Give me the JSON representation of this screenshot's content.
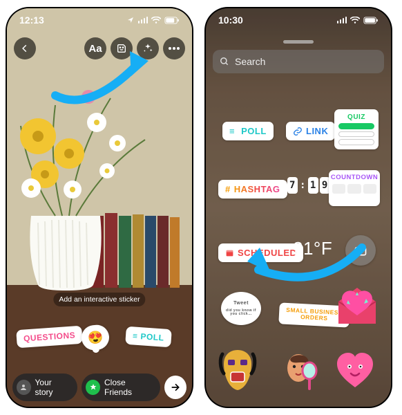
{
  "left": {
    "status_time": "12:13",
    "status_location_icon": "location",
    "hint_text": "Add an interactive sticker",
    "top_buttons": {
      "text": "Aa",
      "sticker": "sticker-icon",
      "effects": "sparkle-icon",
      "more": "more-icon"
    },
    "stickers": {
      "questions": "QUESTIONS",
      "emoji": "😍",
      "poll": "POLL"
    },
    "bottom": {
      "your_story": "Your story",
      "close_friends": "Close Friends"
    }
  },
  "right": {
    "status_time": "10:30",
    "search_placeholder": "Search",
    "stickers": {
      "poll": "POLL",
      "link": "LINK",
      "quiz": "QUIZ",
      "hashtag": "#HASHTAG",
      "time_digits": [
        "7",
        "1",
        "9"
      ],
      "countdown": "COUNTDOWN",
      "scheduled": "SCHEDULED",
      "temperature": "21°F",
      "orders": "SMALL BUSINESS ORDERS"
    }
  }
}
